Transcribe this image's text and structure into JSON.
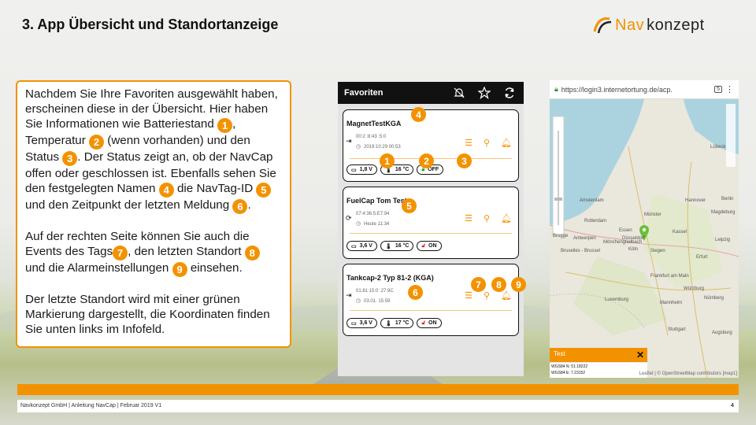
{
  "slide": {
    "title": "3. App Übersicht und Standortanzeige",
    "logo": {
      "part1": "Nav",
      "part2": "konzept"
    }
  },
  "info": {
    "p1": [
      "Nachdem Sie Ihre Favoriten ausgewählt haben, erscheinen diese in der Übersicht. Hier haben Sie Informationen wie Batteriestand",
      "1",
      ", Temperatur",
      "2",
      " (wenn vorhanden) und den Status",
      "3",
      ". Der Status zeigt an, ob der NavCap offen oder geschlossen ist. Ebenfalls sehen Sie den festgelegten Namen",
      "4",
      " die NavTag-ID",
      "5",
      " und den Zeitpunkt der letzten Meldung",
      "6",
      "."
    ],
    "p2": [
      "Auf der rechten Seite können Sie auch die Events des Tags",
      "7",
      ", den letzten Standort",
      "8",
      " und die Alarmeinstellungen",
      "9",
      " einsehen."
    ],
    "p3": "Der letzte Standort wird mit einer grünen Markierung dargestellt, die Koordinaten finden Sie unten links im Infofeld."
  },
  "phone": {
    "header_title": "Favoriten",
    "header_icons": [
      "bell-off-icon",
      "star-icon",
      "refresh-icon"
    ],
    "cards": [
      {
        "name": "MagnetTestKGA",
        "meta1": "00:2 :8:43 :5:0",
        "meta2": "2019:10:29 00:53",
        "battery": "1,8 V",
        "temp": "16 °C",
        "status": "OFF",
        "status_locked": true,
        "badges": [
          "4",
          "1",
          "2",
          "3"
        ]
      },
      {
        "name": "FuelCap Tom Test",
        "meta1": "07:4:36:5:E7:94",
        "meta2": "Heute 11:34",
        "battery": "3,6 V",
        "temp": "16 °C",
        "status": "ON",
        "status_locked": false,
        "badges": [
          "5"
        ]
      },
      {
        "name": "Tankcap-2 Typ 81-2 (KGA)",
        "meta1": "01:81:15:0 :27:9C",
        "meta2": "03.01. 15:59",
        "battery": "3,6 V",
        "temp": "17 °C",
        "status": "ON",
        "status_locked": false,
        "badges": [
          "6",
          "7",
          "8",
          "9"
        ]
      }
    ]
  },
  "map": {
    "url": "https://login3.internetortung.de/acp.",
    "tab_count": "5",
    "labels": [
      "Lübeck",
      "Amsterdam",
      "Hannover",
      "Berlin",
      "Magdeburg",
      "Essen",
      "Münster",
      "Düsseldorf",
      "Köln",
      "Brugge",
      "Antwerpen",
      "Bruxelles - Brussel",
      "Mönchengladbach",
      "Frankfurt am Main",
      "Luxemburg",
      "Stuttgart",
      "Nürnberg",
      "Würzburg",
      "Leipzig",
      "Erfurt",
      "Augsburg",
      "Mannheim",
      "Kassel",
      "Rotterdam",
      "Siegen"
    ],
    "infobox_title": "Test",
    "coords": [
      "WGS84 N: 51.18222",
      "WGS84 E: 7.23152"
    ],
    "attribution": "Leaflet | © OpenStreetMap contributors [map1]"
  },
  "footer": {
    "text": "Navkonzept GmbH | Anleitung NavCap | Februar 2019 V1",
    "page": "4"
  },
  "colors": {
    "accent": "#f39200",
    "marker": "#6bbf3a"
  }
}
